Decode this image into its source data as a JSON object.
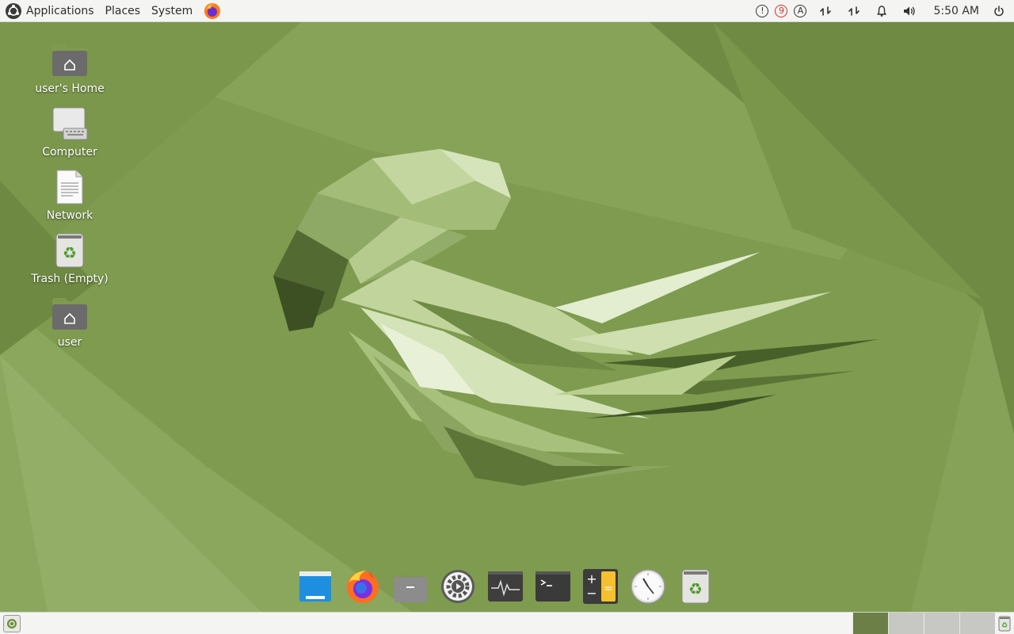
{
  "top_panel": {
    "menus": {
      "applications": "Applications",
      "places": "Places",
      "system": "System"
    },
    "launcher_icon": "firefox-icon",
    "tray": {
      "update_badge": "!",
      "notification_count": "9",
      "keyboard_layout": "A",
      "clock": "5:50 AM"
    },
    "tray_icons": [
      "update-icon",
      "notification-count-icon",
      "keyboard-layout-icon",
      "network-icon",
      "network-icon",
      "bell-icon",
      "volume-icon",
      "power-icon"
    ]
  },
  "desktop": {
    "icons": [
      {
        "name": "desktop-icon-home",
        "label": "user's Home",
        "icon": "home-folder-icon"
      },
      {
        "name": "desktop-icon-computer",
        "label": "Computer",
        "icon": "computer-icon"
      },
      {
        "name": "desktop-icon-network",
        "label": "Network",
        "icon": "network-document-icon"
      },
      {
        "name": "desktop-icon-trash",
        "label": "Trash (Empty)",
        "icon": "trash-icon"
      },
      {
        "name": "desktop-icon-user",
        "label": "user",
        "icon": "home-folder-icon"
      }
    ],
    "accent_color": "#7d9a4e"
  },
  "dock": {
    "items": [
      "window-icon",
      "firefox-icon",
      "files-icon",
      "settings-icon",
      "system-monitor-icon",
      "terminal-icon",
      "calculator-icon",
      "clock-icon",
      "trash-icon"
    ]
  },
  "bottom_panel": {
    "workspace_count": 4,
    "active_workspace": 1
  }
}
